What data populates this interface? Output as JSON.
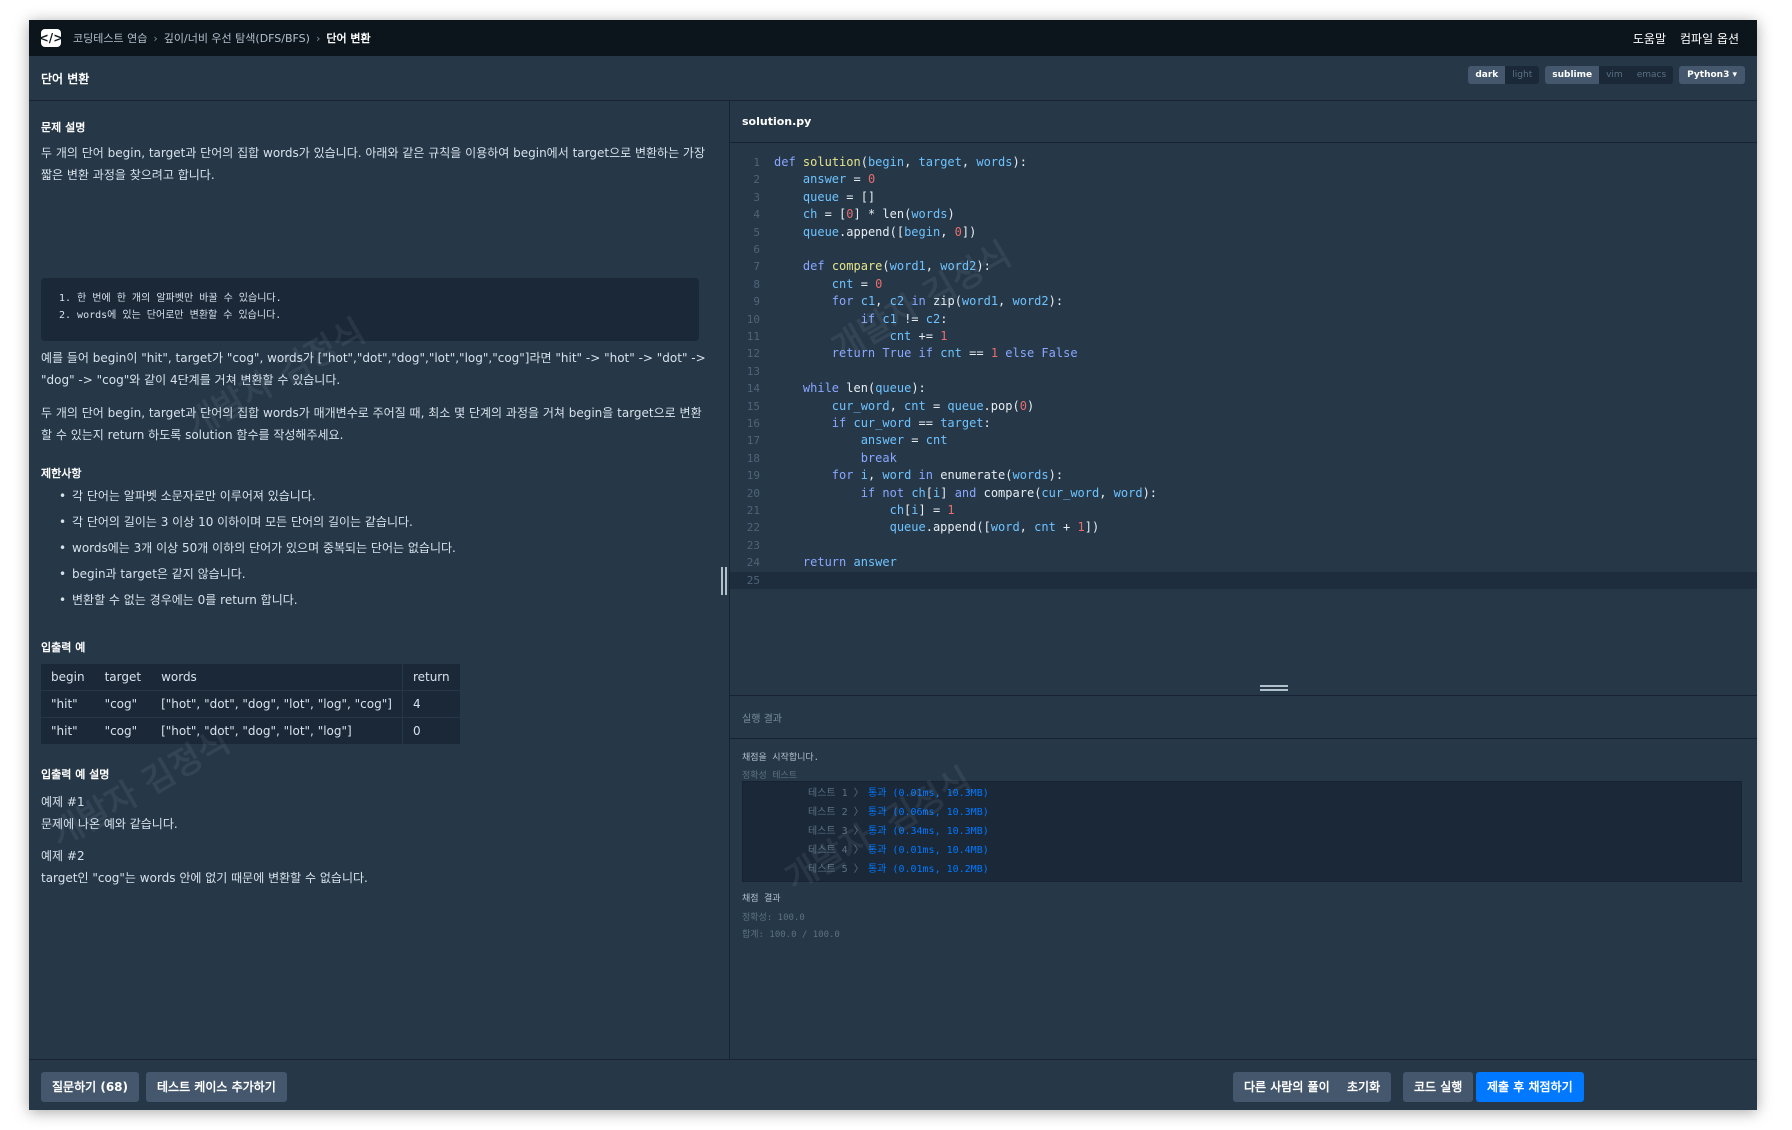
{
  "breadcrumb": {
    "items": [
      "코딩테스트 연습",
      "깊이/너비 우선 탐색(DFS/BFS)",
      "단어 변환"
    ],
    "separator": "›"
  },
  "topnav": {
    "help": "도움말",
    "compile_options": "컴파일 옵션"
  },
  "problem_title": "단어 변환",
  "editor_options": {
    "theme": [
      "dark",
      "light"
    ],
    "theme_selected": "dark",
    "keymap": [
      "sublime",
      "vim",
      "emacs"
    ],
    "keymap_selected": "sublime",
    "language": "Python3 ▾"
  },
  "description": {
    "heading": "문제 설명",
    "para1": "두 개의 단어 begin, target과 단어의 집합 words가 있습니다. 아래와 같은 규칙을 이용하여 begin에서 target으로 변환하는 가장 짧은 변환 과정을 찾으려고 합니다.",
    "rules": [
      "1. 한 번에 한 개의 알파벳만 바꿀 수 있습니다.",
      "2. words에 있는 단어로만 변환할 수 있습니다."
    ],
    "para2": "예를 들어 begin이 \"hit\", target가 \"cog\", words가 [\"hot\",\"dot\",\"dog\",\"lot\",\"log\",\"cog\"]라면 \"hit\" -> \"hot\" -> \"dot\" -> \"dog\" -> \"cog\"와 같이 4단계를 거쳐 변환할 수 있습니다.",
    "para3": "두 개의 단어 begin, target과 단어의 집합 words가 매개변수로 주어질 때, 최소 몇 단계의 과정을 거쳐 begin을 target으로 변환할 수 있는지 return 하도록 solution 함수를 작성해주세요."
  },
  "constraints": {
    "heading": "제한사항",
    "items": [
      "각 단어는 알파벳 소문자로만 이루어져 있습니다.",
      "각 단어의 길이는 3 이상 10 이하이며 모든 단어의 길이는 같습니다.",
      "words에는 3개 이상 50개 이하의 단어가 있으며 중복되는 단어는 없습니다.",
      "begin과 target은 같지 않습니다.",
      "변환할 수 없는 경우에는 0를 return 합니다."
    ]
  },
  "io_example": {
    "heading": "입출력 예",
    "columns": [
      "begin",
      "target",
      "words",
      "return"
    ],
    "rows": [
      [
        "\"hit\"",
        "\"cog\"",
        "[\"hot\", \"dot\", \"dog\", \"lot\", \"log\", \"cog\"]",
        "4"
      ],
      [
        "\"hit\"",
        "\"cog\"",
        "[\"hot\", \"dot\", \"dog\", \"lot\", \"log\"]",
        "0"
      ]
    ]
  },
  "io_explanation": {
    "heading": "입출력 예 설명",
    "ex1_title": "예제 #1",
    "ex1_text": "문제에 나온 예와 같습니다.",
    "ex2_title": "예제 #2",
    "ex2_text": "target인 \"cog\"는 words 안에 없기 때문에 변환할 수 없습니다."
  },
  "editor": {
    "filename": "solution.py",
    "line_numbers": [
      "1",
      "2",
      "3",
      "4",
      "5",
      "6",
      "7",
      "8",
      "9",
      "10",
      "11",
      "12",
      "13",
      "14",
      "15",
      "16",
      "17",
      "18",
      "19",
      "20",
      "21",
      "22",
      "23",
      "24",
      "25"
    ]
  },
  "result": {
    "header": "실행 결과",
    "start": "채점을 시작합니다.",
    "tab_labels": "정확성  테스트",
    "tests": [
      {
        "name": "테스트 1 〉",
        "result": "통과 (0.01ms, 10.3MB)"
      },
      {
        "name": "테스트 2 〉",
        "result": "통과 (0.06ms, 10.3MB)"
      },
      {
        "name": "테스트 3 〉",
        "result": "통과 (0.34ms, 10.3MB)"
      },
      {
        "name": "테스트 4 〉",
        "result": "통과 (0.01ms, 10.4MB)"
      },
      {
        "name": "테스트 5 〉",
        "result": "통과 (0.01ms, 10.2MB)"
      }
    ],
    "grading_heading": "채점 결과",
    "accuracy": "정확성: 100.0",
    "total": "합계: 100.0 / 100.0"
  },
  "buttons": {
    "ask": "질문하기 (68)",
    "add_testcase": "테스트 케이스 추가하기",
    "others": "다른 사람의 풀이",
    "reset": "초기화",
    "run": "코드 실행",
    "submit": "제출 후 채점하기"
  },
  "watermark": "개발자 김정식",
  "colors": {
    "accent": "#0078ff",
    "bg": "#263747",
    "nav": "#0c151c"
  },
  "icons": {
    "logo": "programmers-logo-icon",
    "divider": "vertical-resize-handle-icon",
    "split": "horizontal-resize-handle-icon"
  }
}
